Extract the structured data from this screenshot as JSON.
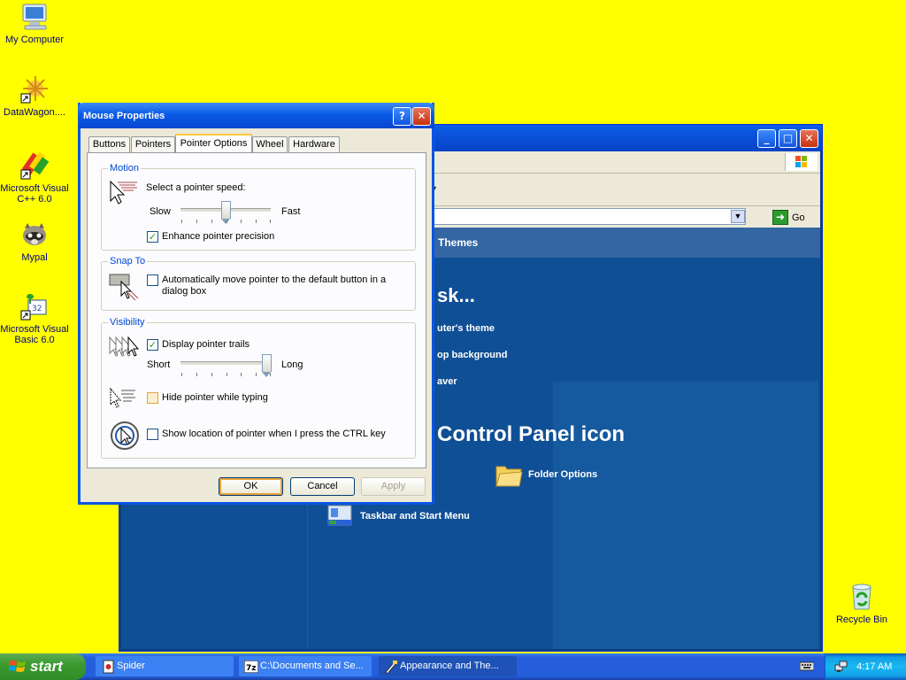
{
  "desktop": {
    "icons": [
      {
        "label": "My Computer",
        "icon": "my-computer-icon"
      },
      {
        "label": "DataWagon....",
        "icon": "datawagon-shortcut-icon"
      },
      {
        "label": "Microsoft Visual C++ 6.0",
        "icon": "visual-cpp-icon"
      },
      {
        "label": "Mypal",
        "icon": "mypal-raccoon-icon"
      },
      {
        "label": "Microsoft Visual Basic 6.0",
        "icon": "visual-basic-icon"
      },
      {
        "label": "Recycle Bin",
        "icon": "recycle-bin-icon"
      }
    ]
  },
  "control_panel": {
    "go_label": "Go",
    "header_fragment": "Themes",
    "task_heading": "sk...",
    "tasks": [
      "uter's theme",
      "op background",
      "aver"
    ],
    "icon_heading": "Control Panel icon",
    "icons": [
      "Folder Options",
      "Taskbar and Start Menu"
    ]
  },
  "dialog": {
    "title": "Mouse Properties",
    "tabs": [
      "Buttons",
      "Pointers",
      "Pointer Options",
      "Wheel",
      "Hardware"
    ],
    "selected_tab": "Pointer Options",
    "motion": {
      "legend": "Motion",
      "speed_label": "Select a pointer speed:",
      "slow": "Slow",
      "fast": "Fast",
      "speed_value": 0.5,
      "precision_label": "Enhance pointer precision",
      "precision_checked": true
    },
    "snap_to": {
      "legend": "Snap To",
      "label": "Automatically move pointer to the default button in a dialog box",
      "checked": false
    },
    "visibility": {
      "legend": "Visibility",
      "trails_label": "Display pointer trails",
      "trails_checked": true,
      "short": "Short",
      "long": "Long",
      "trail_value": 0.95,
      "hide_label": "Hide pointer while typing",
      "hide_checked": false,
      "ctrl_label": "Show location of pointer when I press the CTRL key",
      "ctrl_checked": false
    },
    "buttons": {
      "ok": "OK",
      "cancel": "Cancel",
      "apply": "Apply"
    }
  },
  "taskbar": {
    "start_label": "start",
    "items": [
      "Spider",
      "C:\\Documents and Se...",
      "Appearance and The..."
    ],
    "active_index": 2,
    "clock": "4:17 AM"
  },
  "colors": {
    "desktop_bg": "#ffff00",
    "titlebar_blue": "#0a5be6",
    "cp_content": "#0f4f95",
    "check_green": "#21a121"
  }
}
